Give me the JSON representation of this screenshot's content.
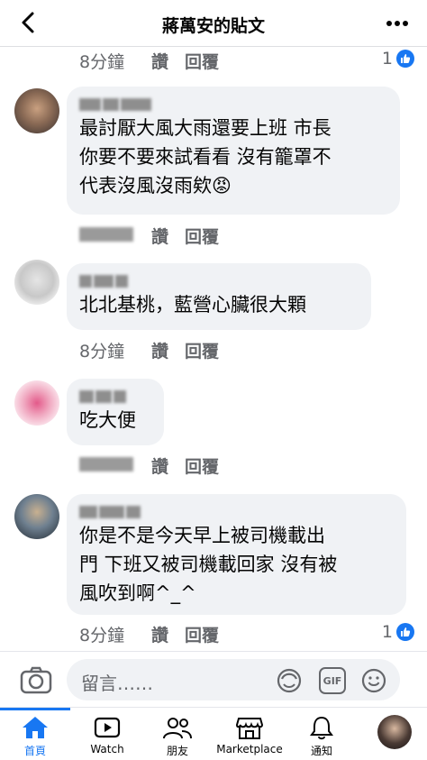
{
  "header": {
    "title": "蔣萬安的貼文"
  },
  "comments": [
    {
      "time": "8分鐘",
      "like": "讚",
      "reply": "回覆",
      "reactions": "1"
    },
    {
      "text": "最討厭大風大雨還要上班 市長\n你要不要來試看看 沒有籠罩不\n代表沒風沒雨欸😡",
      "time": "8分鐘",
      "like": "讚",
      "reply": "回覆"
    },
    {
      "text": "北北基桃，藍營心臟很大顆",
      "time": "8分鐘",
      "like": "讚",
      "reply": "回覆"
    },
    {
      "text": "吃大便",
      "time": "8分鐘",
      "like": "讚",
      "reply": "回覆"
    },
    {
      "text": "你是不是今天早上被司機載出\n門 下班又被司機載回家 沒有被\n風吹到啊^_^",
      "time": "8分鐘",
      "like": "讚",
      "reply": "回覆",
      "reactions": "1"
    }
  ],
  "composer": {
    "placeholder": "留言……",
    "gif_label": "GIF"
  },
  "nav": {
    "items": [
      {
        "label": "首頁"
      },
      {
        "label": "Watch"
      },
      {
        "label": "朋友"
      },
      {
        "label": "Marketplace"
      },
      {
        "label": "通知"
      }
    ]
  },
  "colors": {
    "accent": "#1877f2",
    "bubble": "#f0f2f5",
    "meta": "#65676b"
  }
}
